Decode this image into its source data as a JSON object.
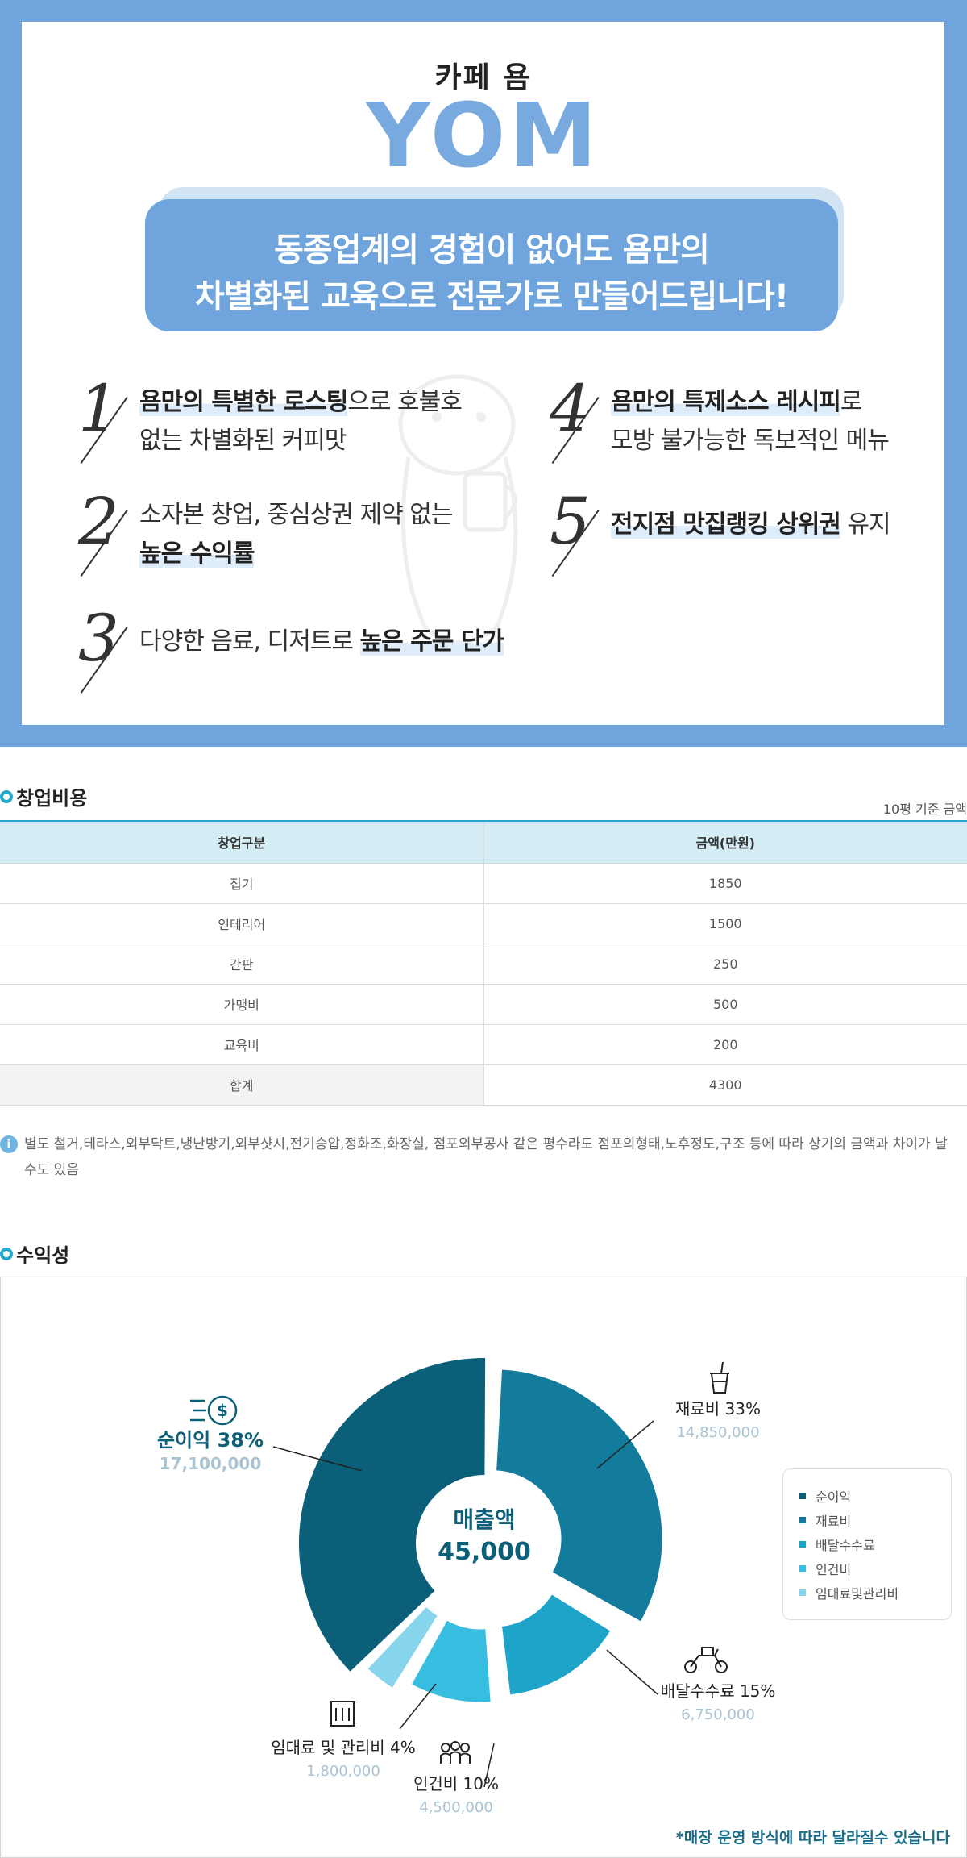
{
  "hero": {
    "brand_ko": "카페 욤",
    "brand_en": "YOM",
    "banner_line1": "동종업계의 경험이 없어도 욤만의",
    "banner_line2": "차별화된 교육으로 전문가로 만들어드립니다!",
    "features": [
      {
        "num": "1",
        "l1_hl": "욤만의 특별한 로스팅",
        "l1_rest": "으로 호불호",
        "l2": "없는 차별화된 커피맛"
      },
      {
        "num": "2",
        "l1": "소자본 창업, 중심상권 제약 없는",
        "l2_hl": "높은 수익률"
      },
      {
        "num": "3",
        "l1": "다양한 음료, 디저트로 ",
        "l1_hl": "높은 주문 단가"
      },
      {
        "num": "4",
        "l1_hl": "욤만의 특제소스 레시피",
        "l1_rest": "로",
        "l2": "모방 불가능한 독보적인 메뉴"
      },
      {
        "num": "5",
        "l1_hl": "전지점 맛집랭킹 상위권",
        "l1_rest": " 유지"
      }
    ]
  },
  "startup": {
    "title": "창업비용",
    "unit_note": "10평 기준 금액",
    "headers": [
      "창업구분",
      "금액(만원)"
    ],
    "rows": [
      [
        "집기",
        "1850"
      ],
      [
        "인테리어",
        "1500"
      ],
      [
        "간판",
        "250"
      ],
      [
        "가맹비",
        "500"
      ],
      [
        "교육비",
        "200"
      ],
      [
        "합계",
        "4300"
      ]
    ],
    "notice": "별도 철거,테라스,외부닥트,냉난방기,외부샷시,전기승압,정화조,화장실, 점포외부공사 같은 평수라도 점포의형태,노후정도,구조 등에 따라 상기의 금액과 차이가 날 수도 있음"
  },
  "profit": {
    "title": "수익성",
    "center_label": "매출액",
    "center_value": "45,000",
    "footnote": "*매장 운영 방식에 따라 달라질수 있습니다",
    "colors": {
      "net": "#0c5f78",
      "material": "#137c9c",
      "delivery": "#1ea4c8",
      "labor": "#37bde0",
      "rent": "#86d5ec"
    },
    "legend": [
      "순이익",
      "재료비",
      "배달수수료",
      "인건비",
      "임대료및관리비"
    ]
  },
  "chart_data": {
    "type": "pie",
    "categories": [
      "순이익",
      "재료비",
      "배달수수료",
      "인건비",
      "임대료 및 관리비"
    ],
    "values": [
      38,
      33,
      15,
      10,
      4
    ],
    "amounts": [
      "17,100,000",
      "14,850,000",
      "6,750,000",
      "4,500,000",
      "1,800,000"
    ],
    "labels": [
      "순이익 38%",
      "재료비 33%",
      "배달수수료 15%",
      "인건비 10%",
      "임대료 및 관리비 4%"
    ],
    "center_text": [
      "매출액",
      "45,000"
    ],
    "legend": [
      "순이익",
      "재료비",
      "배달수수료",
      "인건비",
      "임대료및관리비"
    ],
    "legend_position": "right"
  }
}
